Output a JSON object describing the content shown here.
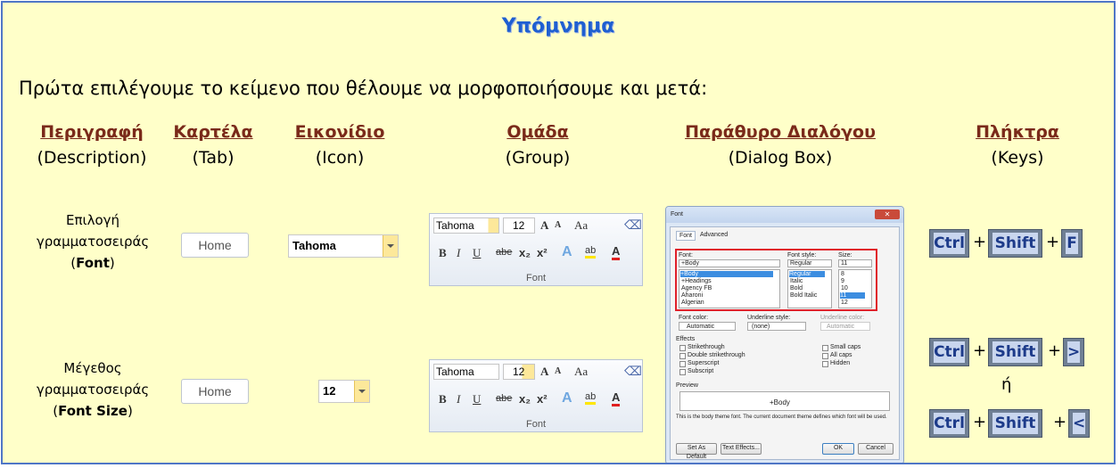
{
  "title": "Υπόμνημα",
  "intro": "Πρώτα επιλέγουμε το κείμενο που θέλουμε να μορφοποιήσουμε και μετά:",
  "columns": [
    {
      "header": "Περιγραφή",
      "sub": "(Description)"
    },
    {
      "header": "Καρτέλα",
      "sub": "(Tab)"
    },
    {
      "header": "Εικονίδιο",
      "sub": "(Icon)"
    },
    {
      "header": "Ομάδα",
      "sub": "(Group)"
    },
    {
      "header": "Παράθυρο Διαλόγου",
      "sub": "(Dialog Box)"
    },
    {
      "header": "Πλήκτρα",
      "sub": "(Keys)"
    }
  ],
  "rows": [
    {
      "desc_line1": "Επιλογή",
      "desc_line2": "γραμματοσειράς",
      "desc_bold": "Font",
      "open_paren": "(",
      "close_paren": ")",
      "tab": "Home",
      "icon_value": "Tahoma",
      "keys": [
        "Ctrl",
        "Shift",
        "F"
      ]
    },
    {
      "desc_line1": "Μέγεθος",
      "desc_line2": "γραμματοσειράς",
      "desc_bold": "Font Size",
      "open_paren": "(",
      "close_paren": ")",
      "tab": "Home",
      "icon_value": "12",
      "keys_a": [
        "Ctrl",
        "Shift",
        ">"
      ],
      "or": "ή",
      "keys_b": [
        "Ctrl",
        "Shift",
        "<"
      ]
    }
  ],
  "plus": "+",
  "group": {
    "font": "Tahoma",
    "size": "12",
    "grow": "A",
    "shrink": "A",
    "case": "Aa",
    "bold": "B",
    "italic": "I",
    "underline": "U",
    "strike": "abe",
    "sub": "x₂",
    "sup": "x²",
    "effects": "A",
    "highlight": "ab",
    "color": "A",
    "label": "Font"
  },
  "dialog": {
    "title": "Font",
    "tabs": [
      "Font",
      "Advanced"
    ],
    "font_label": "Font:",
    "font_value": "+Body",
    "font_list": [
      "+Body",
      "+Headings",
      "Agency FB",
      "Aharoni",
      "Algerian"
    ],
    "style_label": "Font style:",
    "style_value": "Regular",
    "style_list": [
      "Regular",
      "Italic",
      "Bold",
      "Bold Italic"
    ],
    "size_label": "Size:",
    "size_value": "11",
    "size_list": [
      "8",
      "9",
      "10",
      "11",
      "12"
    ],
    "font_color_label": "Font color:",
    "font_color_value": "Automatic",
    "underline_style_label": "Underline style:",
    "underline_style_value": "(none)",
    "underline_color_label": "Underline color:",
    "underline_color_value": "Automatic",
    "effects_label": "Effects",
    "effects_left": [
      "Strikethrough",
      "Double strikethrough",
      "Superscript",
      "Subscript"
    ],
    "effects_right": [
      "Small caps",
      "All caps",
      "Hidden"
    ],
    "preview_label": "Preview",
    "preview_text": "+Body",
    "note": "This is the body theme font. The current document theme defines which font will be used.",
    "buttons": [
      "Set As Default",
      "Text Effects...",
      "OK",
      "Cancel"
    ]
  }
}
